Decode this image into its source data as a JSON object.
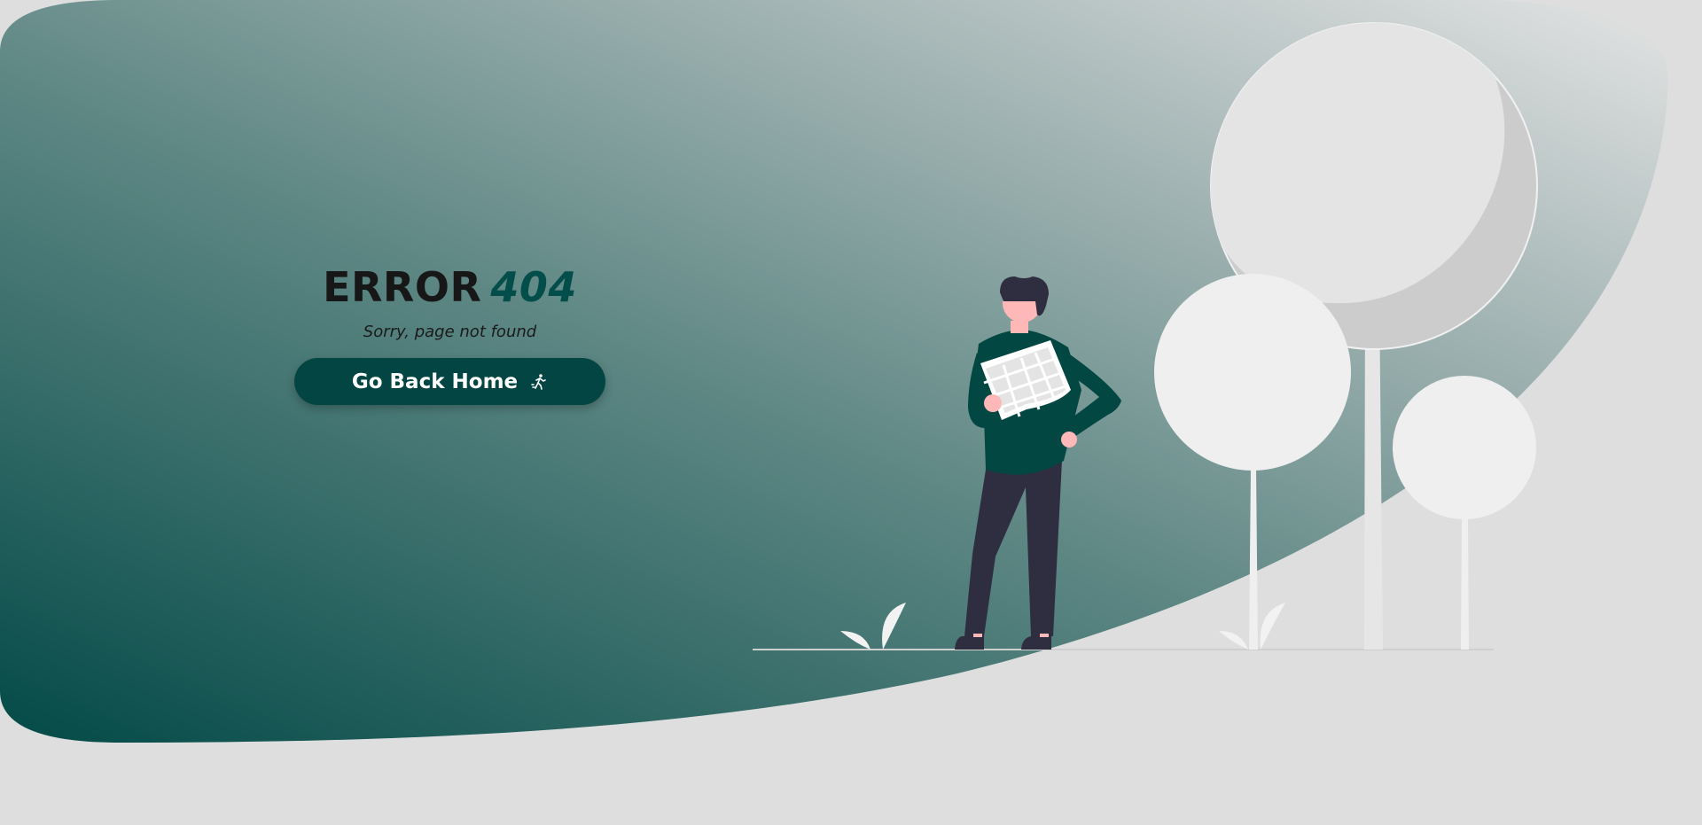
{
  "error": {
    "label": "ERROR",
    "code": "404",
    "subtitle": "Sorry, page not found"
  },
  "button": {
    "label": "Go Back Home",
    "icon": "person-walking-icon"
  },
  "colors": {
    "accent": "#034e4a",
    "button_bg": "#034543",
    "gradient_dark": "#034a47",
    "gradient_light": "#dadcdc",
    "page_bg": "#dedede",
    "trouser": "#2f2e41",
    "skin": "#ffb8b8",
    "tree": "#efefef"
  }
}
